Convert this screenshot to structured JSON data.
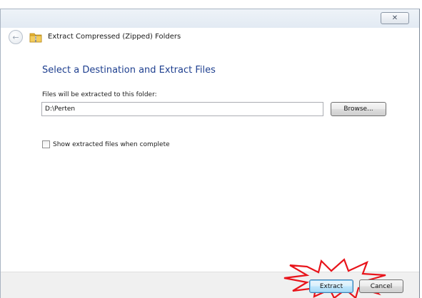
{
  "window": {
    "title": "Extract Compressed (Zipped) Folders",
    "close_glyph": "✕",
    "back_glyph": "←"
  },
  "main": {
    "heading": "Select a Destination and Extract Files",
    "path_label": "Files will be extracted to this folder:",
    "path_value": "D:\\Perten",
    "browse_label": "Browse...",
    "checkbox_label": "Show extracted files when complete",
    "checkbox_checked": false
  },
  "footer": {
    "extract_label": "Extract",
    "cancel_label": "Cancel"
  },
  "colors": {
    "heading": "#1e3f8f",
    "highlight": "#e8141b",
    "folder": "#e8b431"
  },
  "icons": {
    "back": "back-arrow-icon",
    "folder": "zip-folder-icon",
    "close": "close-icon"
  }
}
